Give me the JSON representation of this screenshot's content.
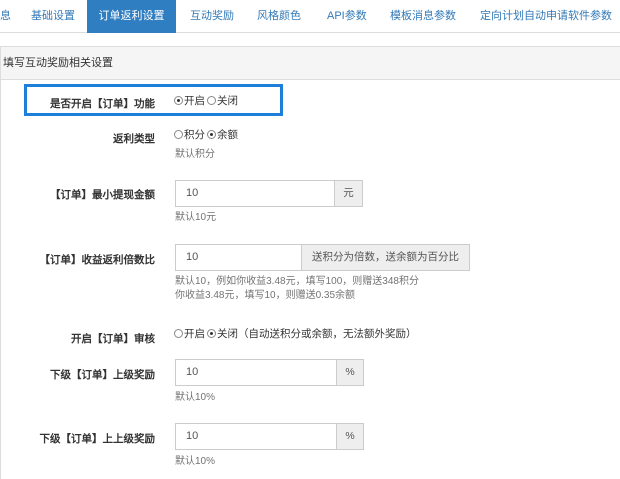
{
  "tabs": [
    {
      "label": "息"
    },
    {
      "label": "基础设置"
    },
    {
      "label": "订单返利设置"
    },
    {
      "label": "互动奖励"
    },
    {
      "label": "风格颜色"
    },
    {
      "label": "API参数"
    },
    {
      "label": "模板消息参数"
    },
    {
      "label": "定向计划自动申请软件参数"
    }
  ],
  "panel": {
    "heading": "填写互动奖励相关设置"
  },
  "form": {
    "order_feature": {
      "label": "是否开启【订单】功能",
      "option_on": "开启",
      "option_off": "关闭",
      "selected": "开启"
    },
    "rebate_type": {
      "label": "返利类型",
      "option_points": "积分",
      "option_balance": "余额",
      "selected": "余额",
      "help": "默认积分"
    },
    "min_withdraw": {
      "label": "【订单】最小提现金额",
      "value": "10",
      "addon": "元",
      "help": "默认10元"
    },
    "rebate_multiple": {
      "label": "【订单】收益返利倍数比",
      "value": "10",
      "addon": "送积分为倍数，送余额为百分比",
      "help_line1": "默认10，例如你收益3.48元，填写100，则赠送348积分",
      "help_line2": "你收益3.48元，填写10，则赠送0.35余额"
    },
    "order_review": {
      "label": "开启【订单】审核",
      "option_on": "开启",
      "option_off": "关闭（自动送积分或余额，无法额外奖励）",
      "selected": "关闭"
    },
    "sub_reward": {
      "label": "下级【订单】上级奖励",
      "value": "10",
      "addon": "%",
      "help": "默认10%"
    },
    "sub_sub_reward": {
      "label": "下级【订单】上上级奖励",
      "value": "10",
      "addon": "%",
      "help": "默认10%"
    }
  },
  "colors": {
    "accent": "#2f7ec2",
    "highlight": "#1e7fd8",
    "link": "#337ab7"
  }
}
